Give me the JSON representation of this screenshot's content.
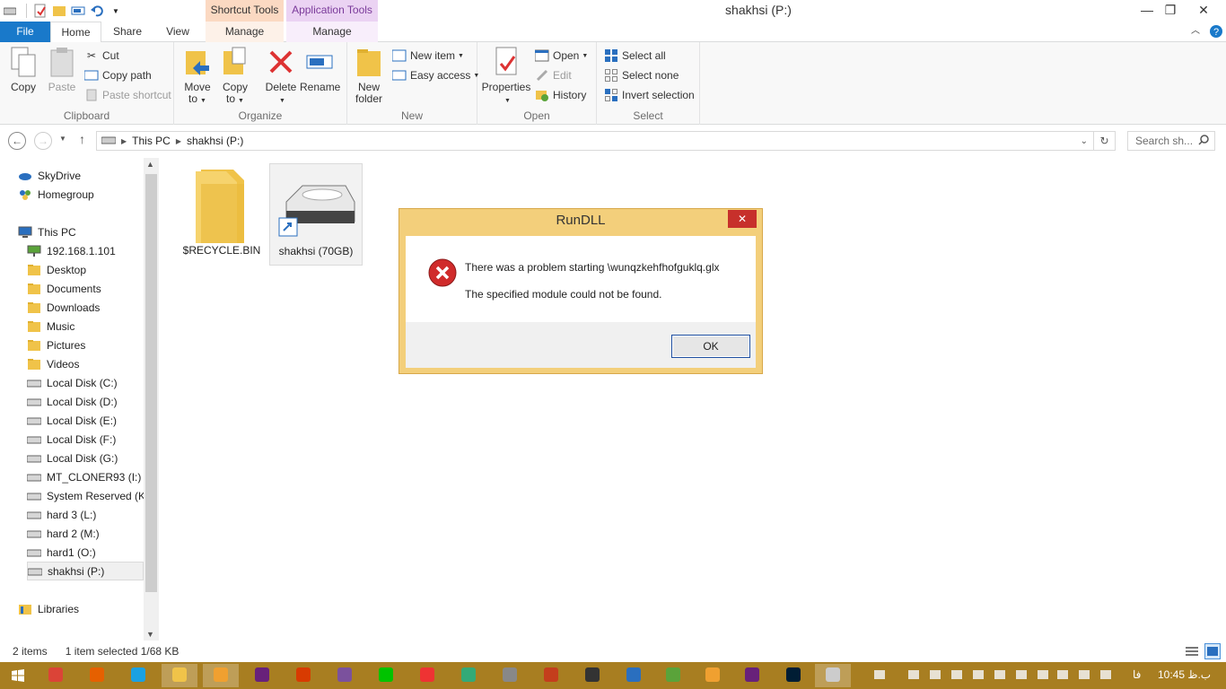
{
  "window": {
    "title": "shakhsi (P:)",
    "context_tabs": [
      "Shortcut Tools",
      "Application Tools"
    ],
    "controls": {
      "minimize": "—",
      "restore": "❐",
      "close": "✕"
    }
  },
  "ribbon_tabs": {
    "file": "File",
    "home": "Home",
    "share": "Share",
    "view": "View",
    "manage1": "Manage",
    "manage2": "Manage"
  },
  "ribbon": {
    "clipboard": {
      "label": "Clipboard",
      "copy": "Copy",
      "paste": "Paste",
      "cut": "Cut",
      "copy_path": "Copy path",
      "paste_shortcut": "Paste shortcut"
    },
    "organize": {
      "label": "Organize",
      "move_to": "Move",
      "move_to2": "to",
      "copy_to": "Copy",
      "copy_to2": "to",
      "delete": "Delete",
      "rename": "Rename"
    },
    "new": {
      "label": "New",
      "new_folder": "New",
      "new_folder2": "folder",
      "new_item": "New item",
      "easy_access": "Easy access"
    },
    "open": {
      "label": "Open",
      "properties": "Properties",
      "open": "Open",
      "edit": "Edit",
      "history": "History"
    },
    "select": {
      "label": "Select",
      "select_all": "Select all",
      "select_none": "Select none",
      "invert": "Invert selection"
    }
  },
  "address": {
    "crumbs": [
      "This PC",
      "shakhsi (P:)"
    ],
    "search_placeholder": "Search sh..."
  },
  "nav": {
    "skydrive": "SkyDrive",
    "homegroup": "Homegroup",
    "this_pc": "This PC",
    "items": [
      "192.168.1.101",
      "Desktop",
      "Documents",
      "Downloads",
      "Music",
      "Pictures",
      "Videos",
      "Local Disk (C:)",
      "Local Disk (D:)",
      "Local Disk (E:)",
      "Local Disk (F:)",
      "Local Disk (G:)",
      "MT_CLONER93 (I:)",
      "System Reserved (K:)",
      "hard 3 (L:)",
      "hard 2 (M:)",
      "hard1 (O:)",
      "shakhsi (P:)"
    ],
    "libraries": "Libraries"
  },
  "files": [
    {
      "name": "$RECYCLE.BIN",
      "icon": "folder-icon"
    },
    {
      "name": "shakhsi (70GB)",
      "icon": "drive-shortcut-icon"
    }
  ],
  "status": {
    "count": "2 items",
    "selected": "1 item selected  1/68 KB"
  },
  "dialog": {
    "title": "RunDLL",
    "message1": "There was a problem starting  \\wunqzkehfhofguklq.glx",
    "message2": "The specified module could not be found.",
    "ok": "OK",
    "close": "✕"
  },
  "taskbar": {
    "clock": "10:45 ب.ظ",
    "lang": "فا",
    "accent": "#a87e21"
  }
}
